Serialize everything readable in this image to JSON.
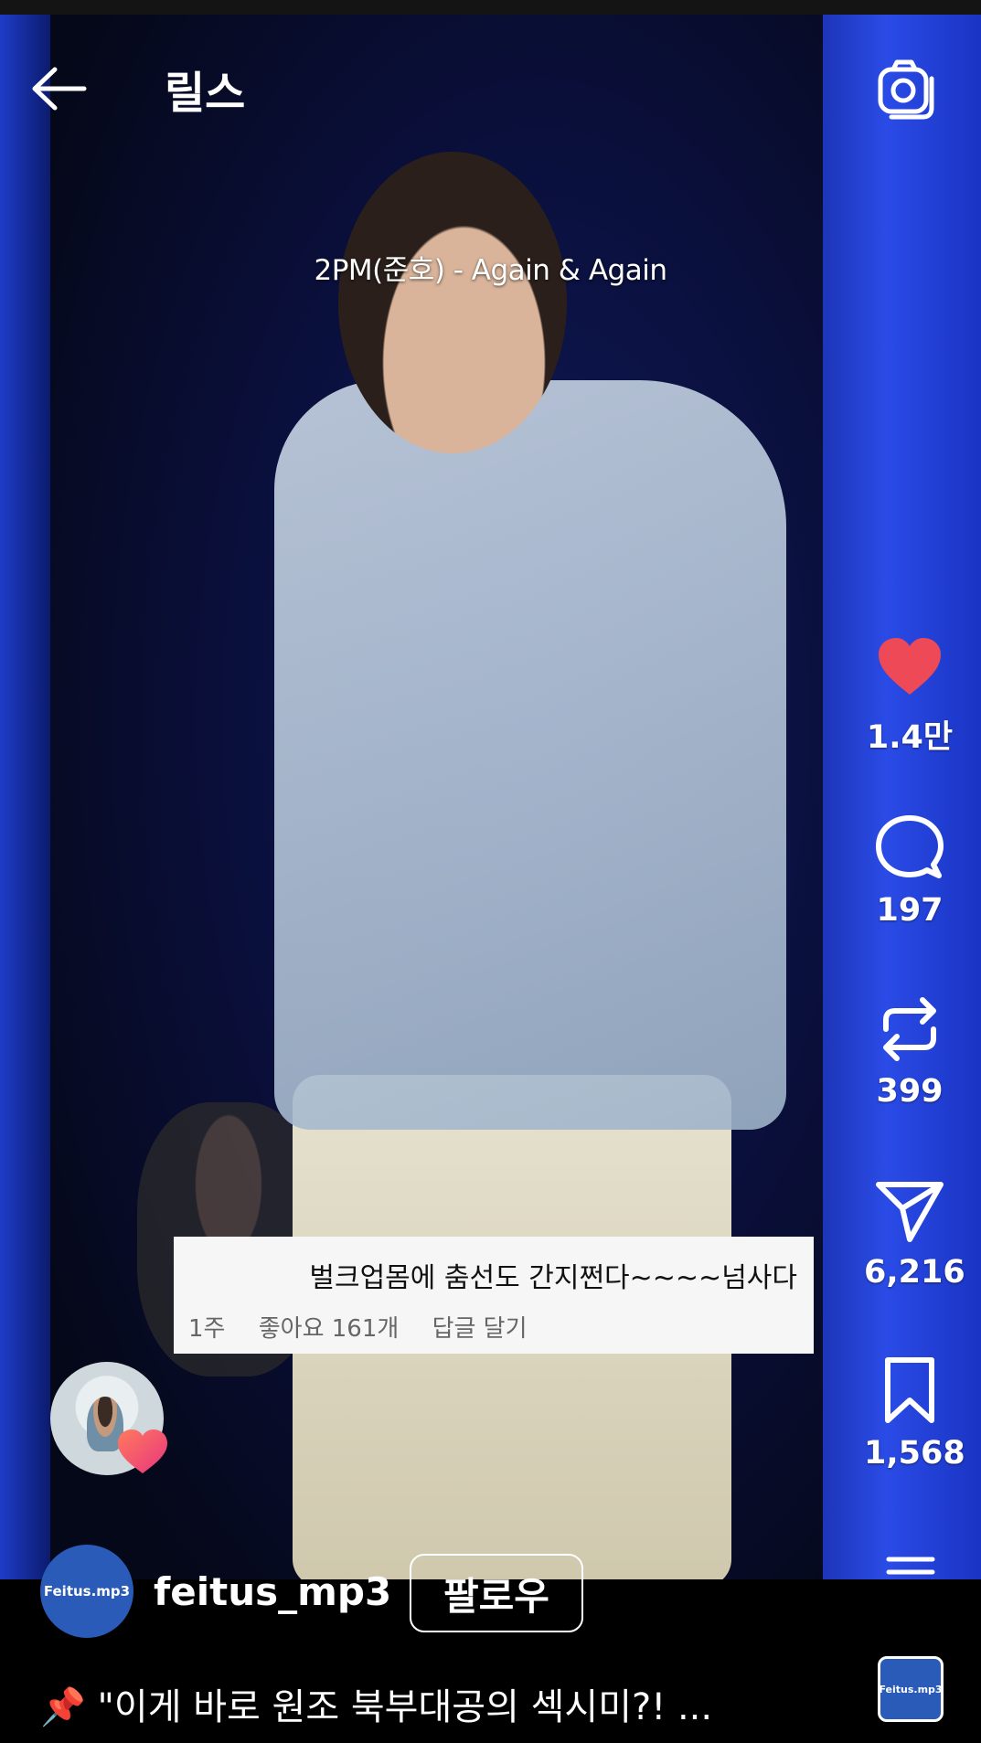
{
  "header": {
    "title": "릴스",
    "back_icon": "arrow-left-icon",
    "camera_icon": "camera-icon"
  },
  "video": {
    "overlay_caption": "2PM(준호) - Again & Again"
  },
  "actions": {
    "like": {
      "icon": "heart-filled-icon",
      "count": "1.4만",
      "color": "#ed4956"
    },
    "comment": {
      "icon": "comment-bubble-icon",
      "count": "197"
    },
    "repost": {
      "icon": "repost-arrows-icon",
      "count": "399"
    },
    "share": {
      "icon": "paper-plane-icon",
      "count": "6,216"
    },
    "save": {
      "icon": "bookmark-icon",
      "count": "1,568"
    }
  },
  "comment_overlay": {
    "text": "벌크업몸에 춤선도 간지쩐다~~~~넘사다",
    "time": "1주",
    "likes": "좋아요 161개",
    "reply": "답글 달기"
  },
  "liker": {
    "avatar_icon": "liker-avatar",
    "heart_icon": "heart-badge-icon",
    "heart_color": "#f04a7a"
  },
  "author": {
    "avatar_text": "Feitus.mp3",
    "username": "feitus_mp3",
    "follow_label": "팔로우",
    "avatar_color": "#2a5bb8"
  },
  "caption": {
    "pin_icon": "📌",
    "text": "\"이게 바로 원조 북부대공의 섹시미?! ..."
  },
  "audio": {
    "thumb_text": "Feitus.mp3"
  }
}
